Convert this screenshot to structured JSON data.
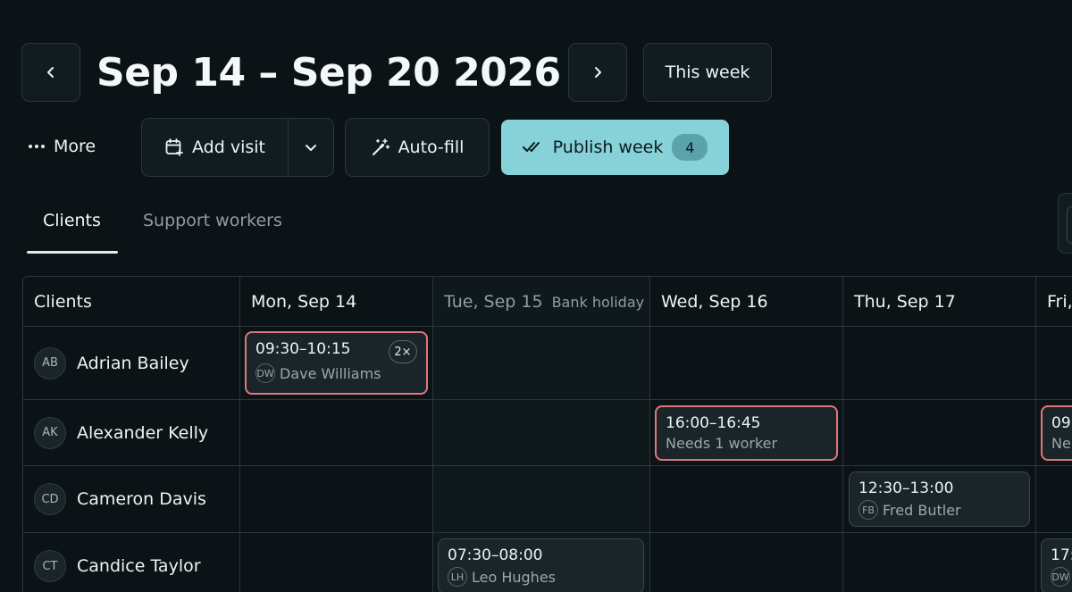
{
  "header": {
    "week_title": "Sep 14 – Sep 20 2026",
    "this_week_label": "This week"
  },
  "toolbar": {
    "more_label": "More",
    "add_visit_label": "Add visit",
    "autofill_label": "Auto-fill",
    "publish_label": "Publish week",
    "publish_count": "4"
  },
  "tabs": [
    {
      "label": "Clients",
      "active": true
    },
    {
      "label": "Support workers",
      "active": false
    }
  ],
  "grid": {
    "first_col_header": "Clients",
    "days": [
      {
        "label": "Mon, Sep 14",
        "holiday": ""
      },
      {
        "label": "Tue, Sep 15",
        "holiday": "Bank holiday"
      },
      {
        "label": "Wed, Sep 16",
        "holiday": ""
      },
      {
        "label": "Thu, Sep 17",
        "holiday": ""
      },
      {
        "label": "Fri,",
        "holiday": ""
      }
    ],
    "clients": [
      {
        "initials": "AB",
        "name": "Adrian Bailey"
      },
      {
        "initials": "AK",
        "name": "Alexander Kelly"
      },
      {
        "initials": "CD",
        "name": "Cameron Davis"
      },
      {
        "initials": "CT",
        "name": "Candice Taylor"
      }
    ],
    "visits": [
      {
        "time": "09:30–10:15",
        "worker_initials": "DW",
        "worker": "Dave Williams",
        "badge": "2×",
        "status": "alert"
      },
      {
        "time": "16:00–16:45",
        "worker_initials": "",
        "worker": "Needs 1 worker",
        "badge": "",
        "status": "alert"
      },
      {
        "time": "09:",
        "worker_initials": "",
        "worker": "Ne",
        "badge": "",
        "status": "alert"
      },
      {
        "time": "12:30–13:00",
        "worker_initials": "FB",
        "worker": "Fred Butler",
        "badge": "",
        "status": "normal"
      },
      {
        "time": "07:30–08:00",
        "worker_initials": "LH",
        "worker": "Leo Hughes",
        "badge": "",
        "status": "normal"
      },
      {
        "time": "17:",
        "worker_initials": "DW",
        "worker": "",
        "badge": "",
        "status": "normal"
      }
    ]
  },
  "colors": {
    "background": "#0b1316",
    "accent": "#86d2d8",
    "alert": "#e0767c"
  },
  "icons": [
    "chevron-left-icon",
    "chevron-right-icon",
    "ellipsis-icon",
    "calendar-plus-icon",
    "chevron-down-icon",
    "magic-wand-icon",
    "double-check-icon"
  ]
}
